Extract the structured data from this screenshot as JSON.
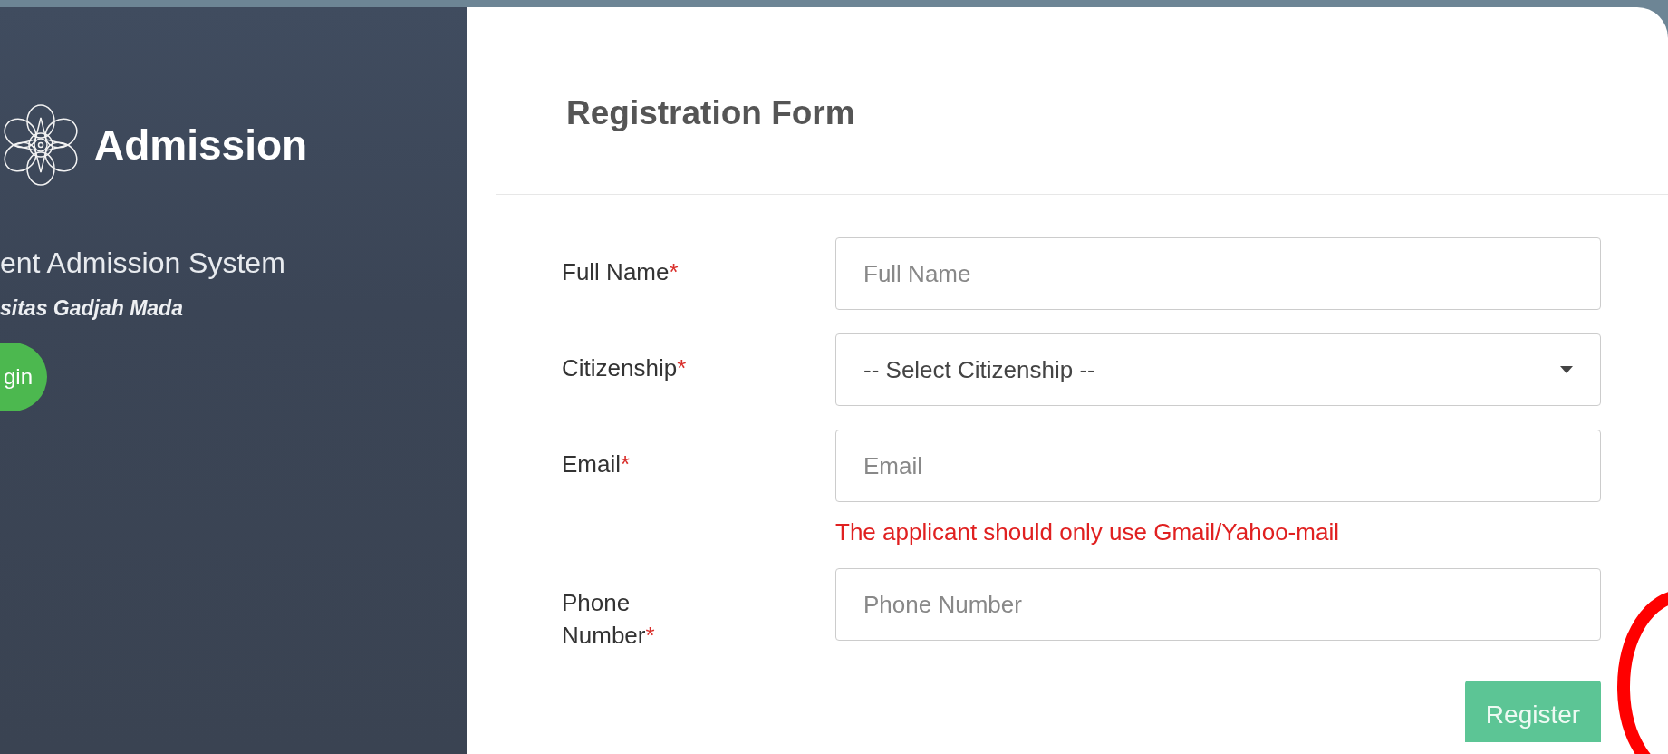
{
  "sidebar": {
    "brand": "Admission",
    "subtitle": "ent Admission System",
    "institution": "sitas Gadjah Mada",
    "login_button": "gin"
  },
  "form": {
    "title": "Registration Form",
    "fields": [
      {
        "kind": "input",
        "label": "Full Name",
        "required_mark": "*",
        "placeholder": "Full Name"
      },
      {
        "kind": "select",
        "label": "Citizenship",
        "required_mark": "*",
        "value": "-- Select Citizenship --"
      },
      {
        "kind": "input",
        "label": "Email",
        "required_mark": "*",
        "placeholder": "Email",
        "help": "The applicant should only use Gmail/Yahoo-mail"
      },
      {
        "kind": "input",
        "label": "Phone Number",
        "required_mark": "*",
        "placeholder": "Phone Number"
      }
    ],
    "submit": "Register"
  }
}
